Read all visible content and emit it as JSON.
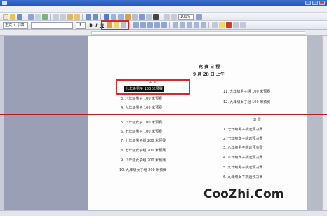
{
  "toolbar": {
    "zoom": "100%",
    "style": "正文 + 小四",
    "font_size": "5"
  },
  "document": {
    "heading_line1": "竞 赛 日 程",
    "heading_line2": "9 月 28 日  上午",
    "left_section_title": "田 赛",
    "selected_item": "七年级男子 100 米预赛",
    "left_items": [
      "八年级男子 100 米预赛",
      "九年级男子 100 米预赛",
      "八年级女子 100 米预赛",
      "七年级男子 100 米预赛",
      "七年级男子组 200 米预赛",
      "七年级女子组 200 米预赛",
      "八年级女子组 200 米预赛",
      "九年级女子组 200 米预赛"
    ],
    "left_item_numbers": [
      "3.",
      "4.",
      "5.",
      "6.",
      "7.",
      "8.",
      "9.",
      "10."
    ],
    "right_items_top": [
      "11. 九年级男子组 100 米预赛",
      "12. 九年级女子组 100 米预赛"
    ],
    "right_section_title": "田 赛",
    "right_items": [
      "1. 七年级男子跳远预决赛",
      "2. 七年级女子跳远预决赛",
      "3. 八年级男子跳远预决赛",
      "4. 八年级女子跳远预决赛",
      "5. 九年级男子跳远预决赛",
      "6. 九年级女子跳远预决赛"
    ]
  },
  "watermark": "CooZhi.Com",
  "colors": {
    "highlight": "#d42a2a",
    "page_bg": "#fdfdfd",
    "side_gray": "#9a9fb5"
  }
}
